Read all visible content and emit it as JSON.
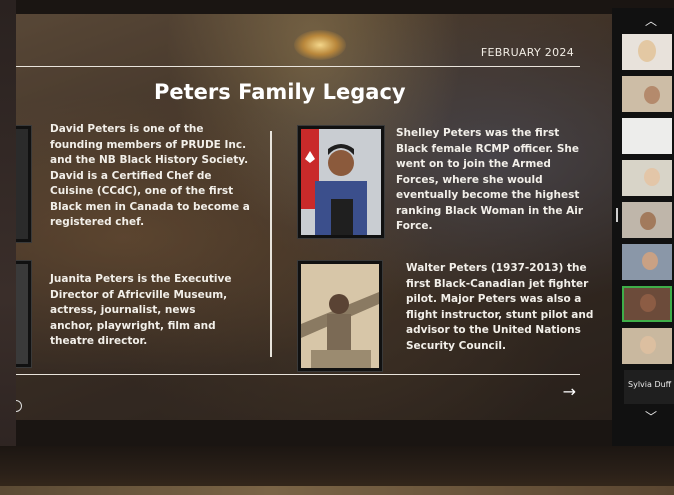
{
  "slide": {
    "date": "FEBRUARY 2024",
    "title": "Peters Family Legacy",
    "next_arrow": "→",
    "people": {
      "david": "David Peters is one of the founding members of PRUDE Inc. and the NB Black History Society. David is a Certified Chef de Cuisine (CCdC), one of the first Black men in Canada to become a registered chef.",
      "juanita": "Juanita Peters is the Executive Director of Africville Museum, actress, journalist, news anchor, playwright, film and theatre director.",
      "shelley": "Shelley Peters  was the first Black  female RCMP officer. She went on to join the Armed Forces, where she would eventually become the highest ranking Black Woman in the Air Force.",
      "walter": "Walter Peters (1937-2013) the first Black-Canadian jet fighter pilot. Major Peters was also a flight instructor, stunt pilot and advisor to the United Nations Security Council."
    }
  },
  "sidebar": {
    "scroll_up": "︿",
    "scroll_down": "﹀",
    "participant_name": "Sylvia Duff"
  },
  "colors": {
    "text": "#f2efe9",
    "sidebar_bg": "#111111",
    "active_tile_border": "#3fae49"
  }
}
